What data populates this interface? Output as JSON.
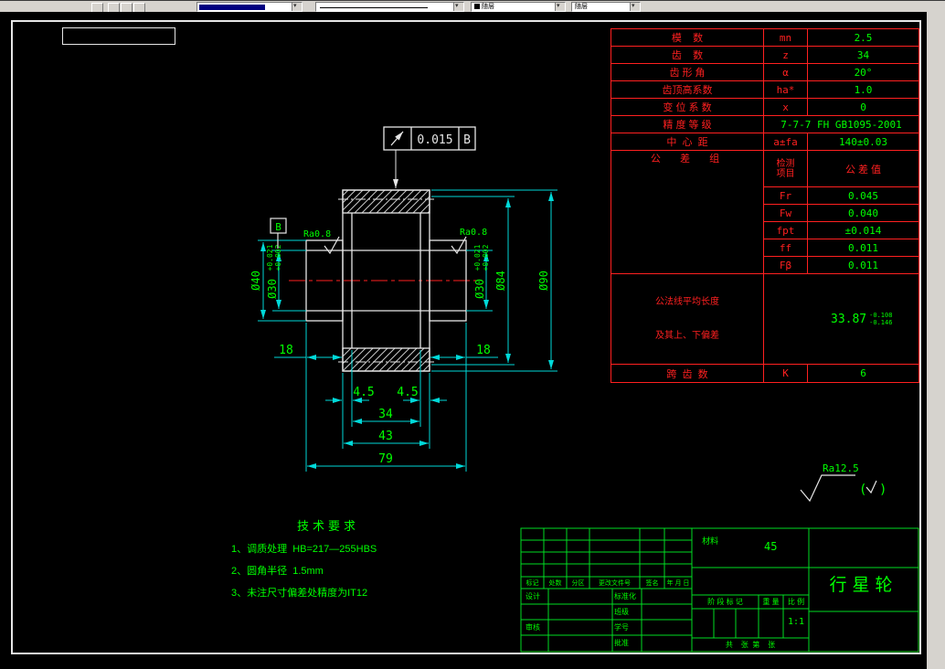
{
  "toolbar": {
    "bylayer_color": "随层",
    "bylayer_lineweight": "随层"
  },
  "drawing": {
    "gdt": {
      "symbol": "circular-runout-arrow",
      "value": "0.015",
      "datum": "B"
    },
    "datum_label": "B",
    "roughness": {
      "left": "Ra0.8",
      "right": "Ra0.8",
      "general": "Ra12.5",
      "paren_open": "(",
      "paren_close": ")"
    },
    "dims": {
      "d40": "Ø40",
      "d30": "Ø30",
      "d30_tol_up": "+0.021",
      "d30_tol_dn": "+0.002",
      "d84": "Ø84",
      "d90": "Ø90",
      "len18_left": "18",
      "len18_right": "18",
      "len45_left": "4.5",
      "len45_right": "4.5",
      "len34": "34",
      "len43": "43",
      "len79": "79"
    }
  },
  "param_table": {
    "simple_rows": [
      {
        "label": "模    数",
        "sym": "mn",
        "val": "2.5"
      },
      {
        "label": "齿    数",
        "sym": "z",
        "val": "34"
      },
      {
        "label": "齿 形 角",
        "sym": "α",
        "val": "20°"
      },
      {
        "label": "齿顶高系数",
        "sym": "ha*",
        "val": "1.0"
      },
      {
        "label": "变 位 系 数",
        "sym": "x",
        "val": "0"
      }
    ],
    "accuracy": {
      "label": "精 度 等 级",
      "val": "7-7-7 FH GB1095-2001"
    },
    "center_dist": {
      "label": "中  心  距",
      "sym": "a±fa",
      "val": "140±0.03"
    },
    "tol_group": {
      "label": "公  差  组",
      "col_item": "检测项目",
      "col_val": "公 差 值"
    },
    "tol_rows": [
      {
        "sym": "Fr",
        "val": "0.045"
      },
      {
        "sym": "Fw",
        "val": "0.040"
      },
      {
        "sym": "fpt",
        "val": "±0.014"
      },
      {
        "sym": "ff",
        "val": "0.011"
      },
      {
        "sym": "Fβ",
        "val": "0.011"
      }
    ],
    "base_tangent": {
      "label1": "公法线平均长度",
      "label2": "及其上、下偏差",
      "val": "33.87",
      "tol_up": "-0.108",
      "tol_dn": "-0.146"
    },
    "span_teeth": {
      "label": "跨  齿  数",
      "sym": "K",
      "val": "6"
    }
  },
  "tech_req": {
    "title": "技术要求",
    "items": [
      "1、调质处理  HB=217—255HBS",
      "2、圆角半径  1.5mm",
      "3、未注尺寸偏差处精度为IT12"
    ]
  },
  "title_block": {
    "material_label": "材料",
    "material_value": "45",
    "part_name": "行星轮",
    "stage_mark": "阶 段 标 记",
    "weight": "重 量",
    "scale": "比 例",
    "scale_value": "1:1",
    "sheets": "共    张  第    张",
    "rev_cols": [
      "标记",
      "处数",
      "分区",
      "更改文件号",
      "签名",
      "年 月 日"
    ],
    "sign_design": "设计",
    "sign_standard": "标准化",
    "sign_class": "班级",
    "sign_student_no": "学号",
    "sign_check": "审核",
    "sign_approve": "批准"
  },
  "colors": {
    "dimension_lines": "#00d9d9",
    "dimension_text": "#00ff00",
    "table_red": "#ff2020",
    "outline_white": "#e6e6e6",
    "centerline_red": "#ff2020",
    "titleblock_green": "#00dd22"
  }
}
